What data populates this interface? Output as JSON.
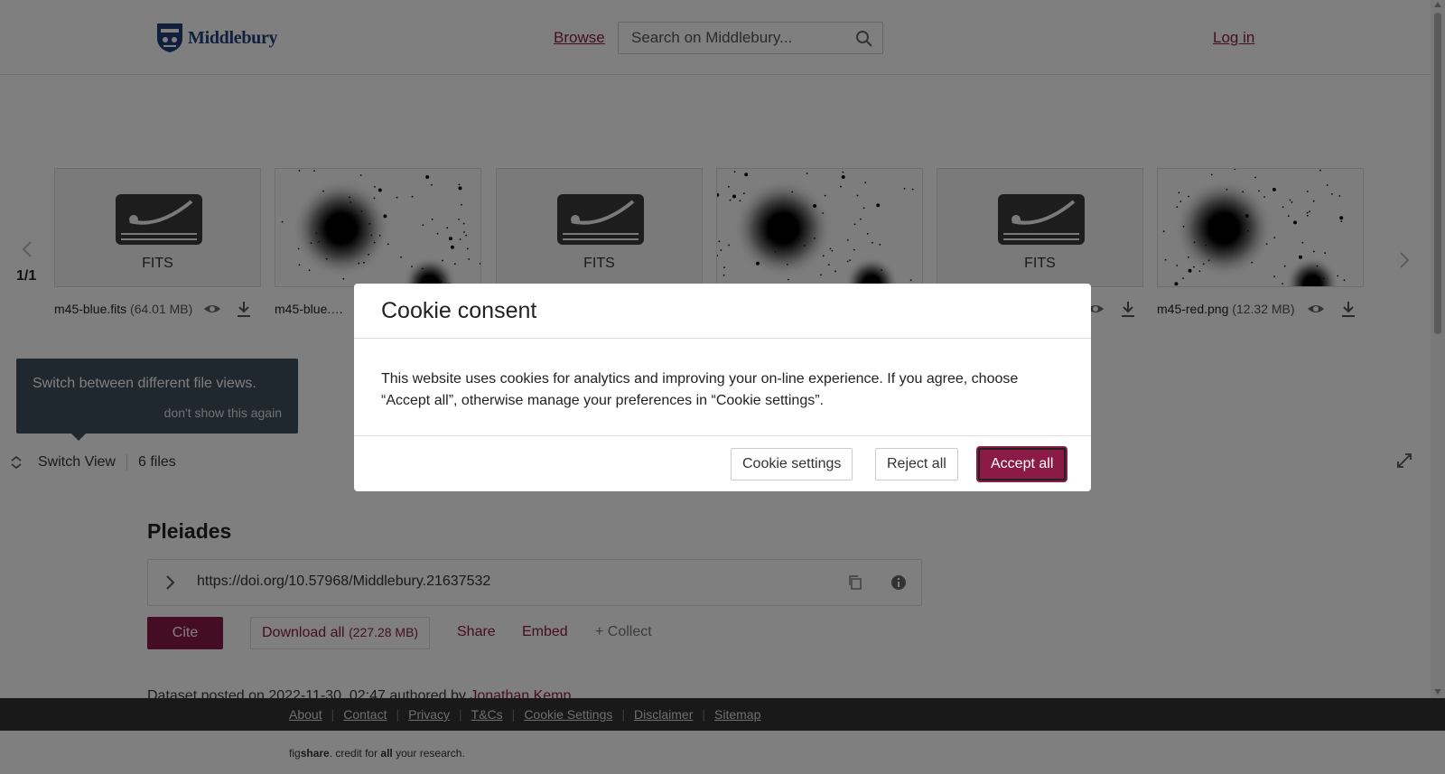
{
  "header": {
    "logo_text": "Middlebury",
    "browse_label": "Browse",
    "search_placeholder": "Search on Middlebury...",
    "login_label": "Log in"
  },
  "carousel": {
    "pager": "1/1",
    "tiles": [
      {
        "type": "FITS",
        "name": "m45-blue.fits",
        "size": "(64.01 MB)"
      },
      {
        "type": "image",
        "name": "m45-blue.…",
        "size": ""
      },
      {
        "type": "FITS",
        "name": "",
        "size": ""
      },
      {
        "type": "image",
        "name": "",
        "size": ""
      },
      {
        "type": "FITS",
        "name": "",
        "size": ""
      },
      {
        "type": "image",
        "name": "m45-red.png",
        "size": "(12.32 MB)"
      }
    ]
  },
  "tooltip": {
    "text": "Switch between different file views.",
    "dismiss": "don't show this again"
  },
  "view_bar": {
    "switch_label": "Switch View",
    "files_count": "6 files"
  },
  "item": {
    "title": "Pleiades",
    "doi": "https://doi.org/10.57968/Middlebury.21637532",
    "cite_label": "Cite",
    "download_label": "Download all",
    "download_size": "(227.28 MB)",
    "share_label": "Share",
    "embed_label": "Embed",
    "collect_label": "+ Collect",
    "posted_text": "Dataset posted on 2022-11-30, 02:47 authored by",
    "author": "Jonathan Kemp"
  },
  "footer": {
    "links": [
      "About",
      "Contact",
      "Privacy",
      "T&Cs",
      "Cookie Settings",
      "Disclaimer",
      "Sitemap"
    ],
    "tagline_pre": "fig",
    "tagline_bold": "share",
    "tagline_mid": ". credit for ",
    "tagline_bold2": "all",
    "tagline_post": " your research."
  },
  "cookie_modal": {
    "title": "Cookie consent",
    "body": "This website uses cookies for analytics and improving your on-line experience. If you agree, choose “Accept all”, otherwise manage your preferences in “Cookie settings”.",
    "settings_label": "Cookie settings",
    "reject_label": "Reject all",
    "accept_label": "Accept all"
  },
  "colors": {
    "brand": "#8b1a47",
    "logo_blue": "#1f3f78",
    "overlay": "rgba(0,0,0,0.5)"
  }
}
